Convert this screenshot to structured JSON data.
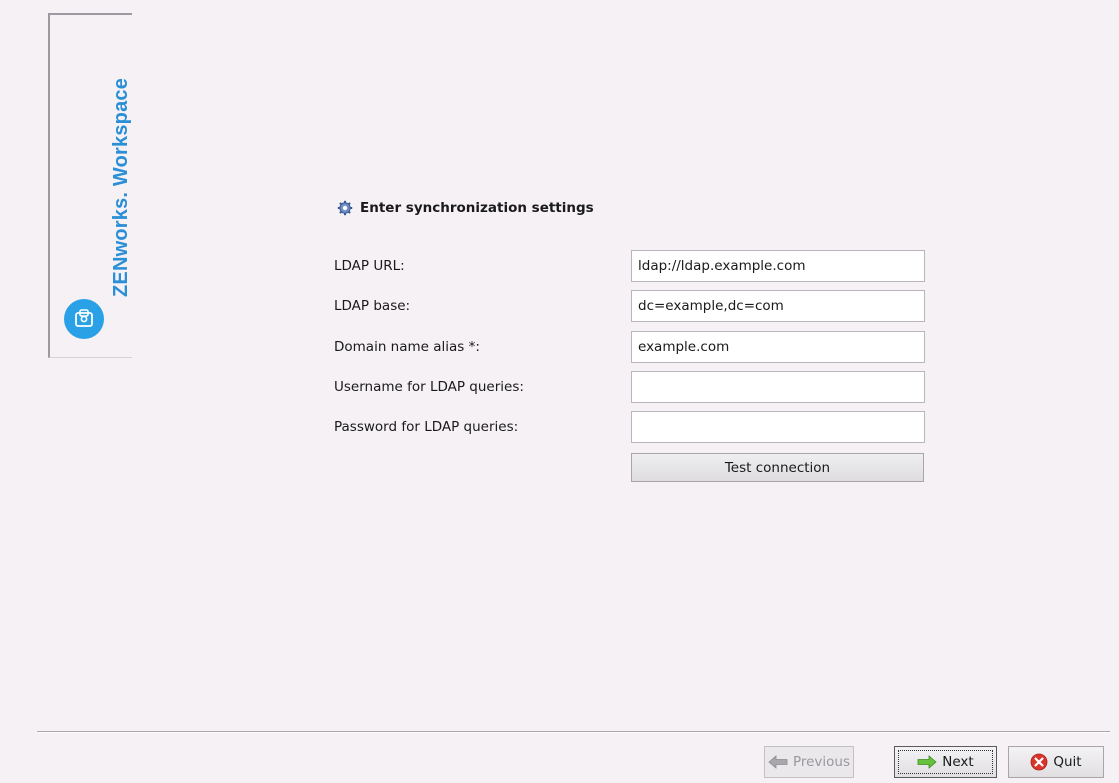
{
  "brand": {
    "name": "ZENworks. Workspace",
    "logo_icon": "workspace-logo-icon",
    "color": "#2a8fd6"
  },
  "section": {
    "title": "Enter synchronization settings",
    "icon": "gear-icon"
  },
  "form": {
    "ldap_url": {
      "label": "LDAP URL:",
      "value": "ldap://ldap.example.com"
    },
    "ldap_base": {
      "label": "LDAP base:",
      "value": "dc=example,dc=com"
    },
    "domain_alias": {
      "label": "Domain name alias *:",
      "value": "example.com"
    },
    "username": {
      "label": "Username for LDAP queries:",
      "value": ""
    },
    "password": {
      "label": "Password for LDAP queries:",
      "value": ""
    },
    "test_button": "Test connection"
  },
  "nav": {
    "previous": "Previous",
    "next": "Next",
    "quit": "Quit"
  }
}
